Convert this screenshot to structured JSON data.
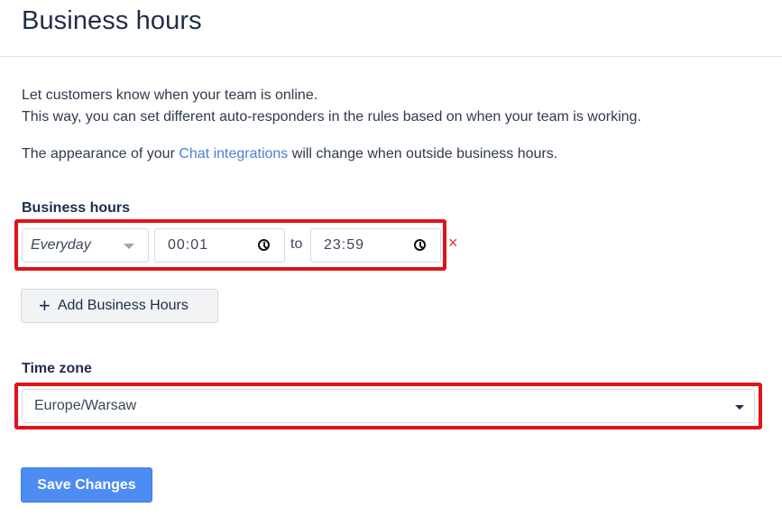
{
  "header": {
    "title": "Business hours"
  },
  "intro": {
    "line1": "Let customers know when your team is online.",
    "line2": "This way, you can set different auto-responders in the rules based on when your team is working.",
    "para2_before": "The appearance of your ",
    "para2_link": "Chat integrations",
    "para2_after": " will change when outside business hours."
  },
  "business_hours": {
    "label": "Business hours",
    "rows": [
      {
        "day": "Everyday",
        "from": "00:01",
        "to_label": "to",
        "to": "23:59",
        "remove_icon": "×"
      }
    ],
    "add_button": {
      "icon": "+",
      "label": "Add Business Hours"
    }
  },
  "time_zone": {
    "label": "Time zone",
    "value": "Europe/Warsaw"
  },
  "save_button": {
    "label": "Save Changes"
  },
  "colors": {
    "highlight": "#e01318",
    "primary": "#4d8cf2",
    "link": "#4a7fd6",
    "remove": "#d9363b"
  }
}
